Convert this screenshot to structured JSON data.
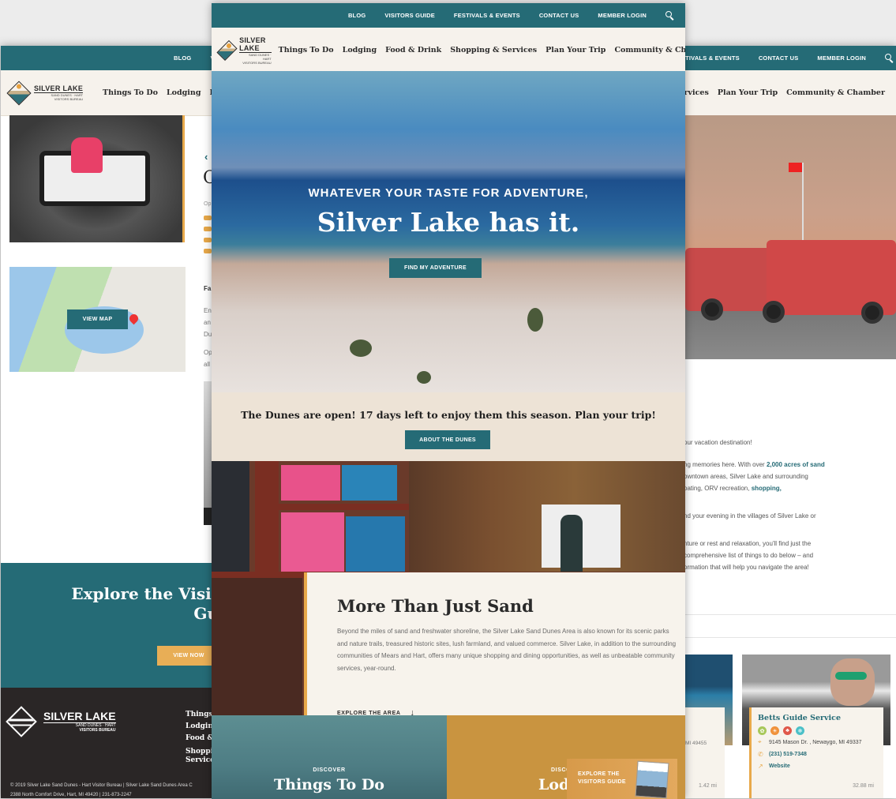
{
  "topbar": {
    "links": [
      "BLOG",
      "VISITORS GUIDE",
      "FESTIVALS & EVENTS",
      "CONTACT US",
      "MEMBER LOGIN"
    ],
    "search_icon": "search-icon"
  },
  "brand": {
    "name": "SILVER LAKE",
    "tagline": "SAND DUNES · HART",
    "sub": "VISITORS BUREAU"
  },
  "nav": {
    "items": [
      "Things To Do",
      "Lodging",
      "Food & Drink",
      "Shopping & Services",
      "Plan Your Trip",
      "Community & Chamber"
    ]
  },
  "left_page": {
    "map_button": "VIEW MAP",
    "title_fragment": "C",
    "snippets": [
      "Op",
      "Fa",
      "En",
      "an",
      "Du",
      "Op",
      "all"
    ],
    "guide_band": {
      "title_line1": "Explore the Visit",
      "title_line2": "Gu",
      "button": "VIEW NOW"
    },
    "footer": {
      "brand_name": "SILVER LAKE",
      "brand_tagline": "SAND DUNES · HART",
      "brand_sub": "VISITORS BUREAU",
      "nav": [
        "Things",
        "Lodging",
        "Food &",
        "Shoppin",
        "Services"
      ],
      "copyright": "© 2019 Silver Lake Sand Dunes - Hart Visitor Bureau   |   Silver Lake Sand Dunes Area C",
      "address": "2388 North Comfort Drive, Hart, MI 49420   |   231-873-2247"
    }
  },
  "center_page": {
    "hero": {
      "eyebrow": "WHATEVER YOUR TASTE FOR ADVENTURE,",
      "headline": "Silver Lake has it.",
      "button": "FIND MY ADVENTURE"
    },
    "alert": {
      "message": "The Dunes are open! 17 days left to enjoy them this season. Plan your trip!",
      "button": "ABOUT THE DUNES"
    },
    "feature": {
      "title": "More Than Just Sand",
      "body": "Beyond the miles of sand and freshwater shoreline, the Silver Lake Sand Dunes Area is also known for its scenic parks and nature trails, treasured historic sites, lush farmland, and valued commerce. Silver Lake, in addition to the surrounding communities of Mears and Hart, offers many unique shopping and dining opportunities, as well as unbeatable community services, year-round.",
      "link": "EXPLORE THE AREA"
    },
    "tiles": [
      {
        "eyebrow": "DISCOVER",
        "title": "Things To Do"
      },
      {
        "eyebrow": "DISCO",
        "title": "Lodg"
      }
    ],
    "guide_popup": {
      "line1": "EXPLORE THE",
      "line2": "VISITORS GUIDE"
    }
  },
  "right_page": {
    "paragraphs": [
      {
        "text": "our vacation destination!"
      },
      {
        "lines": [
          "ng memories here. With over ",
          "2,000 acres of sand",
          "owntown areas, Silver Lake and surrounding",
          "oating, ORV recreation, ",
          "shopping,"
        ]
      },
      {
        "text": "nd your evening in the villages of Silver Lake or"
      },
      {
        "lines": [
          "nture or rest and relaxation, you'll find just the",
          "comprehensive list of things to do below – and",
          "ormation that will help you navigate the area!"
        ]
      }
    ],
    "card_left": {
      "address_fragment": "MI 49455",
      "distance": "1.42 mi"
    },
    "card_right": {
      "name": "Betts Guide Service",
      "season_icons": [
        "spring-icon",
        "summer-icon",
        "fall-icon",
        "winter-icon"
      ],
      "season_colors": [
        "#a8c85a",
        "#f0913a",
        "#e0574a",
        "#4cc0c8"
      ],
      "address": "9145 Mason Dr. , Newaygo, MI 49337",
      "phone": "(231) 519-7348",
      "website": "Website",
      "distance": "32.88 mi"
    }
  },
  "colors": {
    "teal": "#256b76",
    "gold": "#e8a94a",
    "cream": "#f6f2ec",
    "footer_dark": "#2a2626"
  }
}
